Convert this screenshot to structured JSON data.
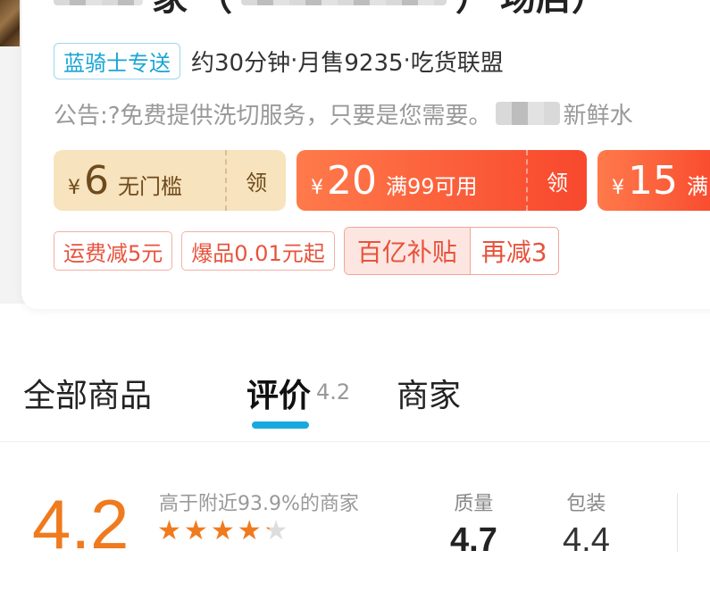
{
  "store": {
    "title_fragment_1": "家",
    "title_fragment_2": "（",
    "title_fragment_3": "）",
    "title_fragment_4": "场店）"
  },
  "info": {
    "delivery_tag": "蓝骑士专送",
    "delivery_time": "约30分钟",
    "sep1": " · ",
    "monthly_sales": "月售9235",
    "sep2": " · ",
    "alliance": "吃货联盟"
  },
  "notice": {
    "text": "公告:?免费提供洗切服务，只要是您需要。",
    "tail": "新鲜水"
  },
  "coupons": [
    {
      "yen": "¥",
      "amount": "6",
      "condition": "无门槛",
      "claim": "领"
    },
    {
      "yen": "¥",
      "amount": "20",
      "condition": "满99可用",
      "claim": "领"
    },
    {
      "yen": "¥",
      "amount": "15",
      "condition": "满"
    }
  ],
  "promos": {
    "shipping": "运费减5元",
    "hot": "爆品0.01元起",
    "subsidy_label": "百亿补贴",
    "subsidy_extra": "再减3"
  },
  "tabs": {
    "all_products": "全部商品",
    "reviews": "评价",
    "reviews_score": "4.2",
    "merchant": "商家"
  },
  "rating": {
    "overall": "4.2",
    "comparison": "高于附近93.9%的商家",
    "stars": 4.2,
    "star_glyph": "★",
    "quality_label": "质量",
    "quality_value": "4.7",
    "packaging_label": "包装",
    "packaging_value": "4.4"
  },
  "colors": {
    "accent_orange": "#f07a1e",
    "tab_underline": "#18a8e0",
    "coupon_red": "#f8482d",
    "coupon_beige": "#f7e3bd",
    "delivery_blue": "#19a5d6"
  }
}
